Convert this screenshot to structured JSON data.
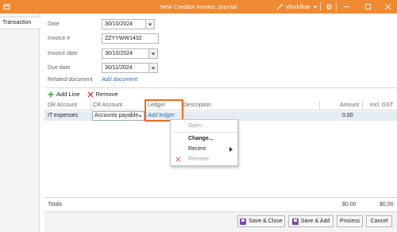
{
  "window": {
    "title": "New Creditor Invoice Journal",
    "workflow_label": "Workflow"
  },
  "sidebar": {
    "tab_label": "Transaction"
  },
  "form": {
    "date": {
      "label": "Date",
      "value": "30/10/2024"
    },
    "invoice_no": {
      "label": "Invoice #",
      "value": "ZZYYWW1432"
    },
    "invoice_date": {
      "label": "Invoice date",
      "value": "30/10/2024"
    },
    "due_date": {
      "label": "Due date",
      "value": "30/11/2024"
    },
    "related_document": {
      "label": "Related document",
      "link": "Add document"
    }
  },
  "toolbar": {
    "add_line": "Add Line",
    "remove": "Remove"
  },
  "columns": {
    "dr_account": "DR Account",
    "cr_account": "CR Account",
    "ledger": "Ledger",
    "description": "Description",
    "amount": "Amount",
    "incl_gst": "Incl. GST"
  },
  "row": {
    "dr_account": "IT expenses",
    "cr_account": "Accounts payable",
    "ledger_link": "Add ledger",
    "amount": "0.00"
  },
  "context_menu": {
    "open": "Open",
    "change": "Change...",
    "recent": "Recent",
    "remove": "Remove"
  },
  "totals": {
    "label": "Totals",
    "amount": "$0.00",
    "incl_gst": "$0.00"
  },
  "buttons": {
    "save_close": "Save & Close",
    "save_add": "Save & Add",
    "process": "Process",
    "cancel": "Cancel"
  },
  "colors": {
    "titlebar": "#f08a32",
    "highlight": "#f06a1e",
    "link": "#2f6db5"
  }
}
